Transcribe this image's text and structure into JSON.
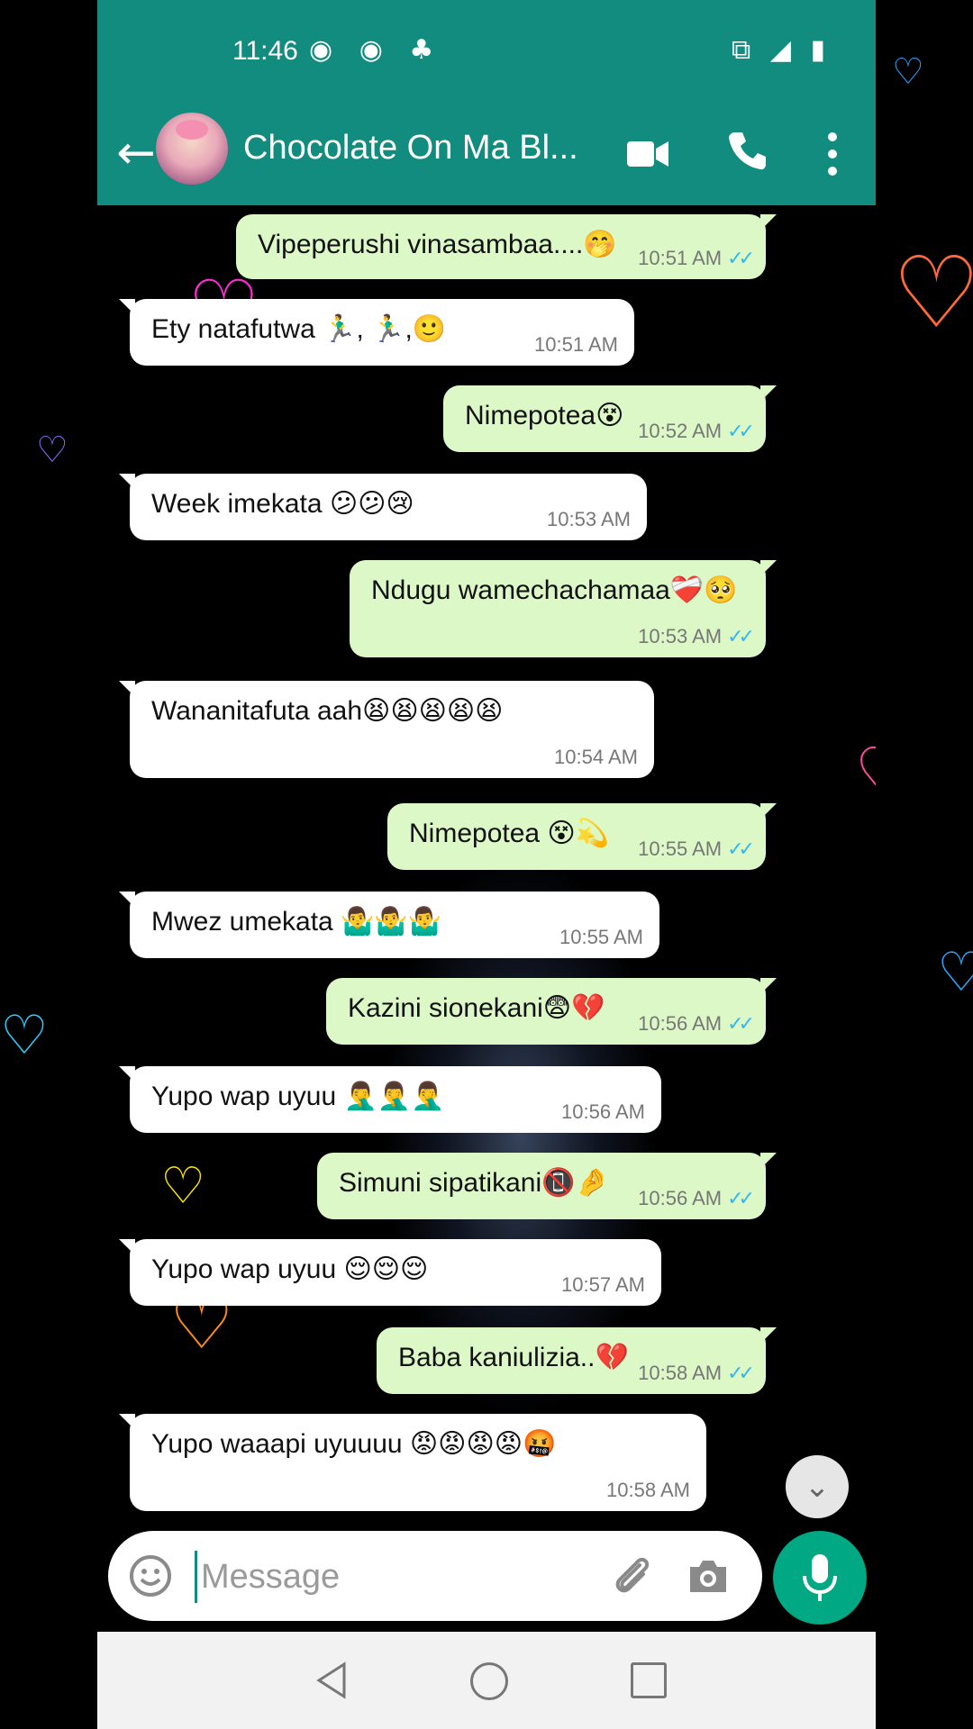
{
  "status_bar": {
    "time": "11:46",
    "left_icons": "◉ ◉ ♣",
    "right_icons": "⧉ ◢ ▮"
  },
  "app_bar": {
    "title": "Chocolate On Ma Bl...",
    "back_glyph": "←"
  },
  "messages": [
    {
      "dir": "out",
      "text": "Vipeperushi vinasambaa....🤭",
      "time": "10:51 AM",
      "ticks": "✓✓"
    },
    {
      "dir": "in",
      "text": "Ety natafutwa 🏃‍♂️, 🏃‍♂️,🙂",
      "time": "10:51 AM"
    },
    {
      "dir": "out",
      "text": "Nimepotea😵",
      "time": "10:52 AM",
      "ticks": "✓✓"
    },
    {
      "dir": "in",
      "text": "Week imekata 😕😕😢",
      "time": "10:53 AM"
    },
    {
      "dir": "out",
      "text": "Ndugu wamechachamaa❤️‍🩹🥺",
      "time": "10:53 AM",
      "ticks": "✓✓"
    },
    {
      "dir": "in",
      "text": "Wananitafuta aah😫😫😫😫😫",
      "time": "10:54 AM"
    },
    {
      "dir": "out",
      "text": "Nimepotea 😵💫",
      "time": "10:55 AM",
      "ticks": "✓✓"
    },
    {
      "dir": "in",
      "text": "Mwez umekata 🤷‍♂️🤷‍♂️🤷‍♂️",
      "time": "10:55 AM"
    },
    {
      "dir": "out",
      "text": "Kazini sionekani😨💔",
      "time": "10:56 AM",
      "ticks": "✓✓"
    },
    {
      "dir": "in",
      "text": "Yupo wap uyuu 🤦‍♂️🤦‍♂️🤦‍♂️",
      "time": "10:56 AM"
    },
    {
      "dir": "out",
      "text": "Simuni sipatikani📵🤌",
      "time": "10:56 AM",
      "ticks": "✓✓"
    },
    {
      "dir": "in",
      "text": "Yupo wap uyuu 😌😌😌",
      "time": "10:57 AM"
    },
    {
      "dir": "out",
      "text": "Baba kaniulizia..💔",
      "time": "10:58 AM",
      "ticks": "✓✓"
    },
    {
      "dir": "in",
      "text": "Yupo waaapi uyuuuu 😡😡😡😡🤬",
      "time": "10:58 AM"
    }
  ],
  "scroll_down_glyph": "⌄",
  "composer": {
    "placeholder": "Message"
  },
  "colors": {
    "header": "#128c7e",
    "outgoing_bubble": "#dcf8c6",
    "incoming_bubble": "#ffffff",
    "mic_button": "#00a884",
    "read_ticks": "#34b7f1"
  },
  "decor": {
    "heart_glyph": "♡"
  }
}
